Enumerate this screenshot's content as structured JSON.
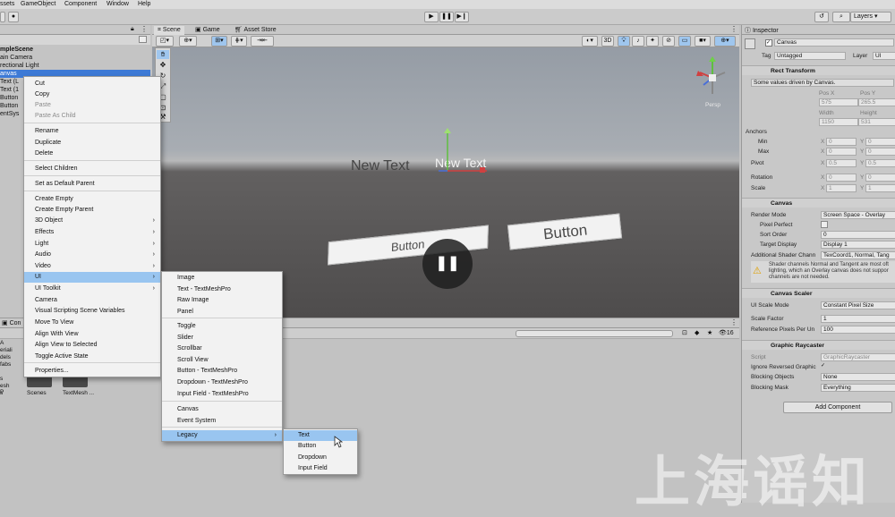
{
  "menubar": {
    "items": [
      "ssets",
      "GameObject",
      "Component",
      "Window",
      "Help"
    ]
  },
  "toolbar": {
    "layers_label": "Layers"
  },
  "hierarchy": {
    "rows": [
      "mpleScene",
      "ain Camera",
      "rectional Light",
      "anvas",
      "Text (L",
      "Text (1",
      "Button",
      "Button",
      "entSys"
    ],
    "selected_index": 3
  },
  "scene_tabs": {
    "scene": "Scene",
    "game": "Game",
    "asset_store": "Asset Store"
  },
  "scene_tools": {
    "view_2d": "3D",
    "persp": "Persp"
  },
  "viewport": {
    "new_text_left": "New Text",
    "new_text_right": "New Text",
    "button_left": "Button",
    "button_right": "Button"
  },
  "context_menu": {
    "items": [
      {
        "label": "Cut",
        "disabled": false,
        "submenu": false
      },
      {
        "label": "Copy",
        "disabled": false,
        "submenu": false
      },
      {
        "label": "Paste",
        "disabled": true,
        "submenu": false
      },
      {
        "label": "Paste As Child",
        "disabled": true,
        "submenu": false
      },
      {
        "label": "Rename",
        "disabled": false,
        "submenu": false
      },
      {
        "label": "Duplicate",
        "disabled": false,
        "submenu": false
      },
      {
        "label": "Delete",
        "disabled": false,
        "submenu": false
      },
      {
        "label": "Select Children",
        "disabled": false,
        "submenu": false
      },
      {
        "label": "Set as Default Parent",
        "disabled": false,
        "submenu": false
      },
      {
        "label": "Create Empty",
        "disabled": false,
        "submenu": false
      },
      {
        "label": "Create Empty Parent",
        "disabled": false,
        "submenu": false
      },
      {
        "label": "3D Object",
        "disabled": false,
        "submenu": true
      },
      {
        "label": "Effects",
        "disabled": false,
        "submenu": true
      },
      {
        "label": "Light",
        "disabled": false,
        "submenu": true
      },
      {
        "label": "Audio",
        "disabled": false,
        "submenu": true
      },
      {
        "label": "Video",
        "disabled": false,
        "submenu": true
      },
      {
        "label": "UI",
        "disabled": false,
        "submenu": true,
        "highlighted": true
      },
      {
        "label": "UI Toolkit",
        "disabled": false,
        "submenu": true
      },
      {
        "label": "Camera",
        "disabled": false,
        "submenu": false
      },
      {
        "label": "Visual Scripting Scene Variables",
        "disabled": false,
        "submenu": false
      },
      {
        "label": "Move To View",
        "disabled": false,
        "submenu": false
      },
      {
        "label": "Align With View",
        "disabled": false,
        "submenu": false
      },
      {
        "label": "Align View to Selected",
        "disabled": false,
        "submenu": false
      },
      {
        "label": "Toggle Active State",
        "disabled": false,
        "submenu": false
      },
      {
        "label": "Properties...",
        "disabled": false,
        "submenu": false
      }
    ]
  },
  "ui_submenu": {
    "items": [
      "Image",
      "Text - TextMeshPro",
      "Raw Image",
      "Panel",
      "Toggle",
      "Slider",
      "Scrollbar",
      "Scroll View",
      "Button - TextMeshPro",
      "Dropdown - TextMeshPro",
      "Input Field - TextMeshPro",
      "Canvas",
      "Event System",
      "Legacy"
    ]
  },
  "legacy_submenu": {
    "items": [
      "Text",
      "Button",
      "Dropdown",
      "Input Field"
    ]
  },
  "project": {
    "tab_label": "Con",
    "left_items": [
      "A",
      "eriali",
      "dels",
      "fabs",
      "",
      "s",
      "esh P",
      "s"
    ],
    "folders": [
      "Scenes",
      "TextMesh ..."
    ],
    "count": "16"
  },
  "inspector": {
    "tab": "Inspector",
    "object_name": "Canvas",
    "tag_label": "Tag",
    "tag_value": "Untagged",
    "layer_label": "Layer",
    "layer_value": "UI",
    "rect_transform": {
      "title": "Rect Transform",
      "note": "Some values driven by Canvas.",
      "pos_x_label": "Pos X",
      "pos_y_label": "Pos Y",
      "pos_x": "575",
      "pos_y": "265.5",
      "width_label": "Width",
      "height_label": "Height",
      "width": "1150",
      "height": "531",
      "anchors": "Anchors",
      "min": "Min",
      "max": "Max",
      "min_x": "0",
      "min_y": "0",
      "max_x": "0",
      "max_y": "0",
      "pivot": "Pivot",
      "pivot_x": "0.5",
      "pivot_y": "0.5",
      "rotation": "Rotation",
      "rot_x": "0",
      "rot_y": "0",
      "scale": "Scale",
      "scale_x": "1",
      "scale_y": "1"
    },
    "canvas": {
      "title": "Canvas",
      "render_mode_label": "Render Mode",
      "render_mode": "Screen Space - Overlay",
      "pixel_perfect": "Pixel Perfect",
      "sort_order_label": "Sort Order",
      "sort_order": "0",
      "target_display_label": "Target Display",
      "target_display": "Display 1",
      "shader_channels_label": "Additional Shader Chann",
      "shader_channels": "TexCoord1, Normal, Tang",
      "warning_line1": "Shader channels Normal and Tangent are most oft",
      "warning_line2": "lighting, which an Overlay canvas does not suppor",
      "warning_line3": "channels are not needed."
    },
    "canvas_scaler": {
      "title": "Canvas Scaler",
      "ui_scale_mode_label": "UI Scale Mode",
      "ui_scale_mode": "Constant Pixel Size",
      "scale_factor_label": "Scale Factor",
      "scale_factor": "1",
      "ref_ppu_label": "Reference Pixels Per Un",
      "ref_ppu": "100"
    },
    "graphic_raycaster": {
      "title": "Graphic Raycaster",
      "script_label": "Script",
      "script": "GraphicRaycaster",
      "ignore_label": "Ignore Reversed Graphic",
      "blocking_objects_label": "Blocking Objects",
      "blocking_objects": "None",
      "blocking_mask_label": "Blocking Mask",
      "blocking_mask": "Everything"
    },
    "add_component": "Add Component"
  },
  "watermark": "上海谣知",
  "colors": {
    "highlight": "#99c5f0",
    "hier_selected": "#3d7ad6",
    "play_overlay": "#222222"
  }
}
